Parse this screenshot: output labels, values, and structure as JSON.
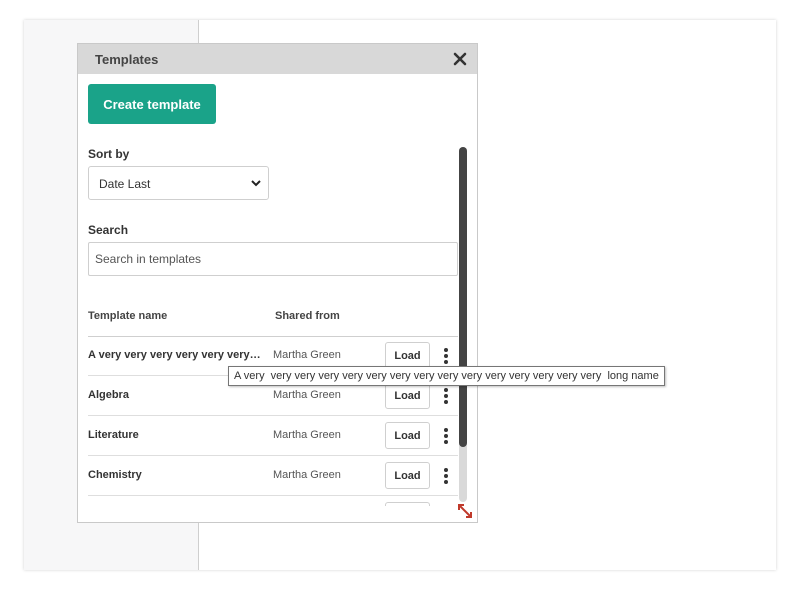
{
  "panel": {
    "title": "Templates",
    "create_button_label": "Create template",
    "accent_color": "#1aa389"
  },
  "sort": {
    "label": "Sort by",
    "selected": "Date Last"
  },
  "search": {
    "label": "Search",
    "placeholder": "Search in templates",
    "value": ""
  },
  "table": {
    "columns": [
      "Template name",
      "Shared from"
    ],
    "load_label": "Load",
    "rows": [
      {
        "name": "A very very very very very very…",
        "shared_from": "Martha Green"
      },
      {
        "name": "Algebra",
        "shared_from": "Martha Green"
      },
      {
        "name": "Literature",
        "shared_from": "Martha Green"
      },
      {
        "name": "Chemistry",
        "shared_from": "Martha Green"
      }
    ]
  },
  "tooltip": {
    "text": "A very  very very very very very very very very very very very very very very  long name"
  },
  "icons": {
    "close": "close-icon",
    "chevron": "chevron-down-icon",
    "row_menu": "kebab-menu-icon",
    "resize": "resize-icon"
  }
}
